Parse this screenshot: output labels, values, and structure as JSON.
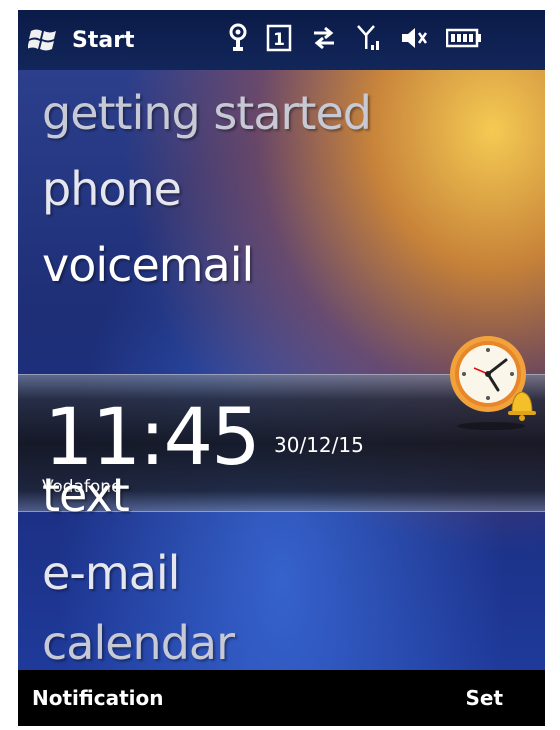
{
  "status_bar": {
    "start_label": "Start",
    "icons": [
      "windows-flag-icon",
      "bluetooth-icon",
      "sim-1-icon",
      "data-transfer-icon",
      "signal-icon",
      "speaker-muted-icon",
      "battery-icon"
    ],
    "sim_number": "1"
  },
  "home": {
    "menu": {
      "getting_started": "getting started",
      "phone": "phone",
      "voicemail": "voicemail",
      "text": "text",
      "email": "e-mail",
      "calendar": "calendar"
    },
    "clock": {
      "time": "11:45",
      "date": "30/12/15",
      "operator": "Vodafone",
      "icon": "alarm-clock-icon"
    }
  },
  "softkeys": {
    "left": "Notification",
    "right": "Set"
  },
  "colors": {
    "softkey_bar": "#000000",
    "status_bar": "#0b1b48",
    "active_text": "#ffffff",
    "dim_text": "#c7c9d4",
    "accent_glow": "#f4b43a"
  }
}
